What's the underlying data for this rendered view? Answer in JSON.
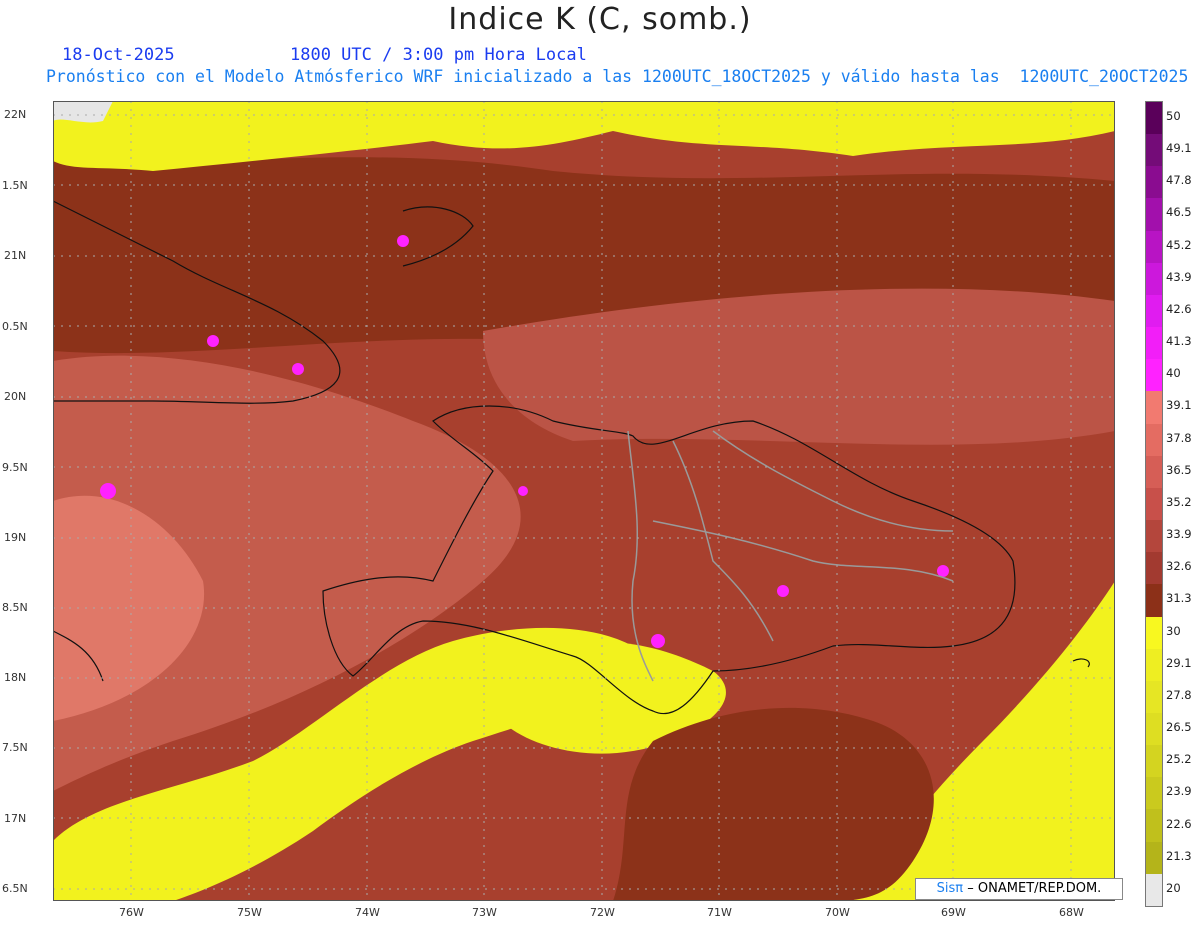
{
  "header": {
    "title": "Indice K (C, somb.)",
    "date": "18-Oct-2025",
    "utc_time": "1800 UTC / 3:00 pm Hora Local",
    "description": "Pronóstico con el Modelo Atmósferico WRF inicializado a las 1200UTC_18OCT2025 y válido hasta las  1200UTC_20OCT2025"
  },
  "map": {
    "lat_labels": [
      "22N",
      "1.5N",
      "21N",
      "0.5N",
      "20N",
      "9.5N",
      "19N",
      "8.5N",
      "18N",
      "7.5N",
      "17N",
      "6.5N"
    ],
    "lon_labels": [
      "76W",
      "75W",
      "74W",
      "73W",
      "72W",
      "71W",
      "70W",
      "69W",
      "68W"
    ]
  },
  "colorbar": {
    "labels": [
      "50",
      "49.1",
      "47.8",
      "46.5",
      "45.2",
      "43.9",
      "42.6",
      "41.3",
      "40",
      "39.1",
      "37.8",
      "36.5",
      "35.2",
      "33.9",
      "32.6",
      "31.3",
      "30",
      "29.1",
      "27.8",
      "26.5",
      "25.2",
      "23.9",
      "22.6",
      "21.3",
      "20"
    ],
    "colors": [
      "#5a005a",
      "#740c78",
      "#8a0c90",
      "#a210ac",
      "#b814c4",
      "#cc18dc",
      "#e01cf0",
      "#f21ef8",
      "#ff22ff",
      "#f27a70",
      "#e46c62",
      "#d65e56",
      "#c8504a",
      "#b4463c",
      "#a23a30",
      "#8c3018",
      "#f8f820",
      "#eeee22",
      "#e6e624",
      "#dede22",
      "#d4d420",
      "#caca1e",
      "#c0c01c",
      "#b4b41a",
      "#e8e8e8"
    ]
  },
  "credit": {
    "sis": "Sisπ",
    "text": "– ONAMET/REP.DOM."
  }
}
